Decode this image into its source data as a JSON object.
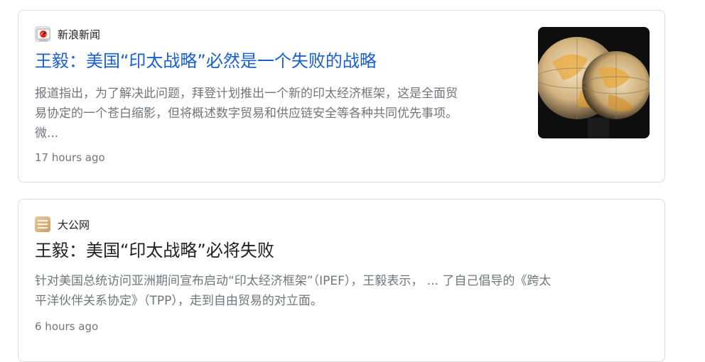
{
  "results": [
    {
      "source": "新浪新闻",
      "favicon": "sina-logo-icon",
      "title": "王毅：美国“印太战略”必然是一个失败的战略",
      "title_color": "#1a5fd0",
      "snippet_lines": [
        "报道指出，为了解决此问题，拜登计划推出一个新的印太经济框架，这是全面贸",
        "易协定的一个苍白缩影，但将概述数字贸易和供应链安全等各种共同优先事项。",
        "微..."
      ],
      "time": "17 hours ago",
      "thumbnail": "globe-image"
    },
    {
      "source": "大公网",
      "favicon": "dagong-logo-icon",
      "title": "王毅：美国“印太战略”必将失败",
      "title_color": "#202124",
      "snippet_lines": [
        "针对美国总统访问亚洲期间宣布启动“印太经济框架”（IPEF），王毅表示， ... 了自己倡导的《跨太",
        "平洋伙伴关系协定》（TPP），走到自由贸易的对立面。"
      ],
      "time": "6 hours ago"
    }
  ]
}
